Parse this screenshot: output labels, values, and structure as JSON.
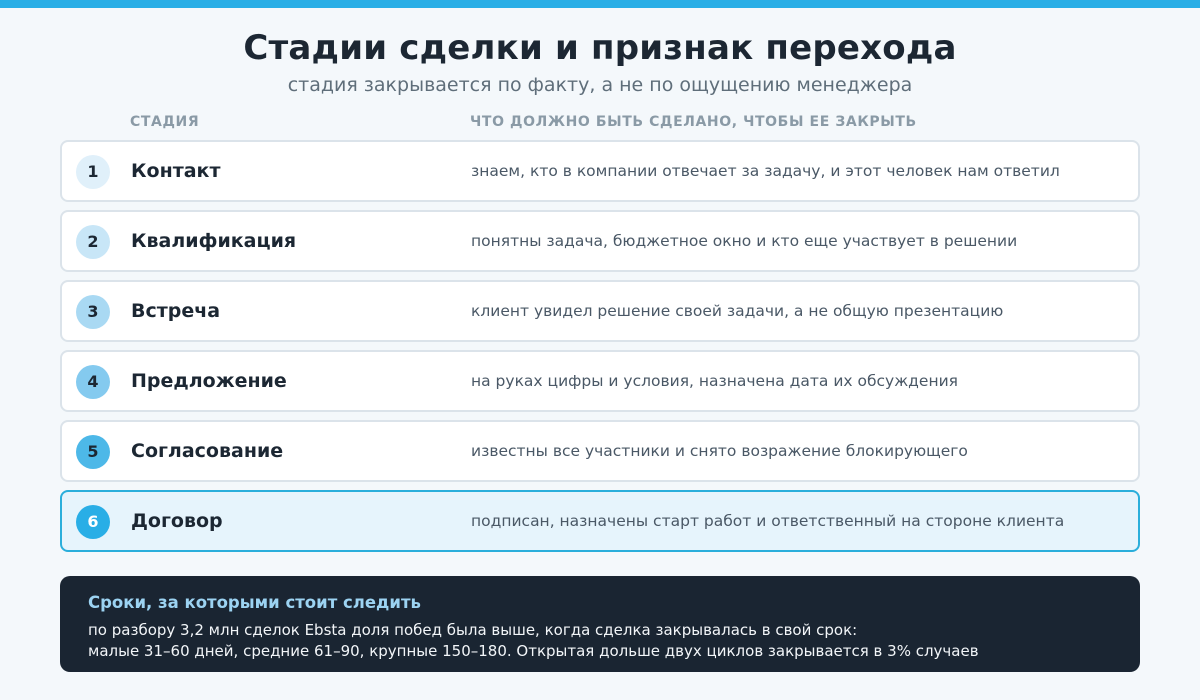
{
  "header": {
    "title": "Стадии сделки и признак перехода",
    "subtitle": "стадия закрывается по факту, а не по ощущению менеджера"
  },
  "columns": {
    "stage": "СТАДИЯ",
    "done": "ЧТО ДОЛЖНО БЫТЬ СДЕЛАНО, ЧТОБЫ ЕЕ ЗАКРЫТЬ"
  },
  "colors": {
    "accent": "#29aee6",
    "badge_light": "#d6ecf8",
    "badge_dark": "#29a3df"
  },
  "stages": [
    {
      "num": "1",
      "name": "Контакт",
      "criterion": "знаем, кто в компании отвечает за задачу, и этот человек нам ответил"
    },
    {
      "num": "2",
      "name": "Квалификация",
      "criterion": "понятны задача, бюджетное окно и кто еще участвует в решении"
    },
    {
      "num": "3",
      "name": "Встреча",
      "criterion": "клиент увидел решение своей задачи, а не общую презентацию"
    },
    {
      "num": "4",
      "name": "Предложение",
      "criterion": "на руках цифры и условия, назначена дата их обсуждения"
    },
    {
      "num": "5",
      "name": "Согласование",
      "criterion": "известны все участники и снято возражение блокирующего"
    },
    {
      "num": "6",
      "name": "Договор",
      "criterion": "подписан, назначены старт работ и ответственный на стороне клиента"
    }
  ],
  "note": {
    "title": "Сроки, за которыми стоит следить",
    "line1": "по разбору 3,2 млн сделок Ebsta доля побед была выше, когда сделка закрывалась в свой срок:",
    "line2": "малые 31–60 дней, средние 61–90, крупные 150–180. Открытая дольше двух циклов закрывается в 3% случаев"
  }
}
